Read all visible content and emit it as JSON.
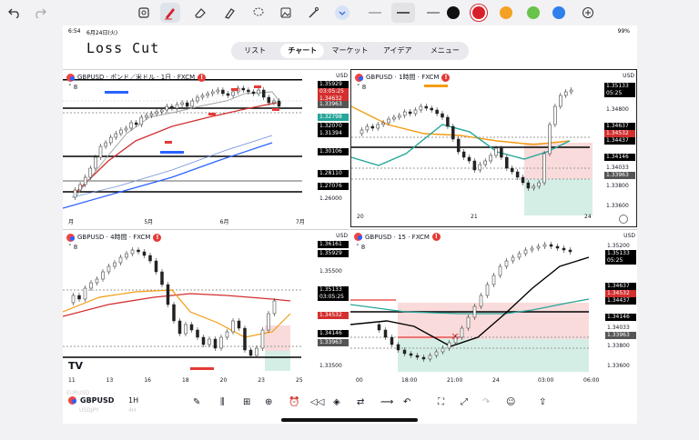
{
  "toolbar": {
    "colors": [
      "#111111",
      "#d9202a",
      "#f4a125",
      "#69c24a",
      "#2f80ed"
    ],
    "icons": [
      "undo-icon",
      "redo-icon",
      "scan-icon",
      "pen-icon",
      "eraser-icon",
      "highlighter-icon",
      "lasso-icon",
      "image-icon",
      "magic-icon",
      "chevron-down-icon",
      "thin-line-icon",
      "medium-line-icon",
      "color-picker-add-icon"
    ]
  },
  "status": {
    "time": "6:54",
    "date": "6月24日(火)",
    "right": "99%"
  },
  "note_title": "Loss Cut",
  "tabs": [
    "リスト",
    "チャート",
    "マーケット",
    "アイデア",
    "メニュー"
  ],
  "active_tab": "チャート",
  "panels": [
    {
      "title": "GBPUSD · ポンド／米ドル · 1日 · FXCM",
      "sub": "8",
      "currency": "USD",
      "prices": [
        "1.35929",
        "03:05:25",
        "1.34632",
        "1.33963",
        "1.32798",
        "1.32070",
        "1.31394",
        "1.30106",
        "1.28110",
        "1.27076",
        "1.26000"
      ],
      "x": [
        "月",
        "5月",
        "6月",
        "7月"
      ]
    },
    {
      "title": "GBPUSD · 1時間 · FXCM",
      "sub": "8",
      "currency": "USD",
      "prices": [
        "1.35133",
        "05:25",
        "1.34800",
        "1.34637",
        "1.34532",
        "1.34437",
        "1.34146",
        "1.34033",
        "1.33963",
        "1.33800",
        "1.33600"
      ],
      "x": [
        "20",
        "21",
        "24"
      ]
    },
    {
      "title": "GBPUSD · 4時間 · FXCM",
      "sub": "8",
      "currency": "USD",
      "prices": [
        "1.36161",
        "1.35929",
        "1.35500",
        "1.35133",
        "03:05:25",
        "1.34532",
        "1.34146",
        "1.33963",
        "1.33500"
      ],
      "x": [
        "11",
        "13",
        "16",
        "18",
        "20",
        "23",
        "25"
      ]
    },
    {
      "title": "GBPUSD · 15 · FXCM",
      "sub": "8",
      "currency": "USD",
      "prices": [
        "1.35200",
        "1.35133",
        "05:25",
        "1.34637",
        "1.34532",
        "1.34437",
        "1.34146",
        "1.34033",
        "1.33963",
        "1.33800",
        "1.33600"
      ],
      "x": [
        "00",
        "18:00",
        "21:00",
        "24",
        "03:00",
        "06:00"
      ]
    }
  ],
  "bottom": {
    "symbol": "GBPUSD",
    "interval": "1H",
    "ghost1": "EURUSD",
    "ghost2": "USDJPY",
    "ghost3": "4H",
    "icons": [
      "draw-icon",
      "indicator-icon",
      "layout-icon",
      "add-icon",
      "alert-icon",
      "replay-icon",
      "layers-icon",
      "settings-icon",
      "compare-icon",
      "undo-icon",
      "fullscreen-icon",
      "expand-icon",
      "redo-icon",
      "bulb-icon",
      "share-icon"
    ]
  },
  "logo": "TV"
}
